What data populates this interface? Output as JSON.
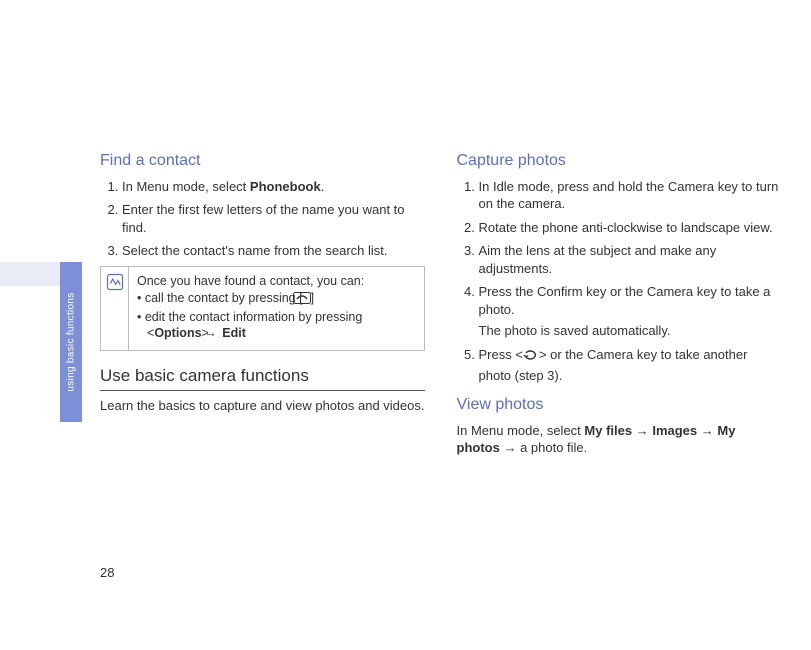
{
  "side": {
    "label": "using basic functions"
  },
  "pageNumber": "28",
  "left": {
    "h_find": "Find a contact",
    "find_steps": [
      {
        "pre": "In Menu mode, select ",
        "bold": "Phonebook",
        "post": "."
      },
      {
        "pre": "Enter the first few letters of the name you want to find.",
        "bold": "",
        "post": ""
      },
      {
        "pre": "Select the contact's name from the search list.",
        "bold": "",
        "post": ""
      }
    ],
    "note": {
      "intro": "Once you have found a contact, you can:",
      "b1_pre": "• call the contact by pressing [",
      "b1_post": "]",
      "b2_pre": "• edit the contact information by pressing <",
      "b2_options": "Options",
      "b2_mid": "> ",
      "b2_arrow": "→",
      "b2_edit": " Edit"
    },
    "h_cam": "Use basic camera functions",
    "cam_intro": "Learn the basics to capture and view photos and videos."
  },
  "right": {
    "h_capture": "Capture photos",
    "capture_steps": [
      "In Idle mode, press and hold the Camera key to turn on the camera.",
      "Rotate the phone anti-clockwise to landscape view.",
      "Aim the lens at the subject and make any adjustments."
    ],
    "capture_step4_line1": "Press the Confirm key or the Camera key to take a photo.",
    "capture_step4_line2": "The photo is saved automatically.",
    "capture_step5_pre": "Press <",
    "capture_step5_post": "> or the Camera key to take another photo (step 3).",
    "h_view": "View photos",
    "view_pre": "In Menu mode, select ",
    "view_b1": "My files",
    "view_a1": " → ",
    "view_b2": "Images",
    "view_a2": " → ",
    "view_b3": "My photos",
    "view_a3": " → ",
    "view_post": "a photo file."
  }
}
